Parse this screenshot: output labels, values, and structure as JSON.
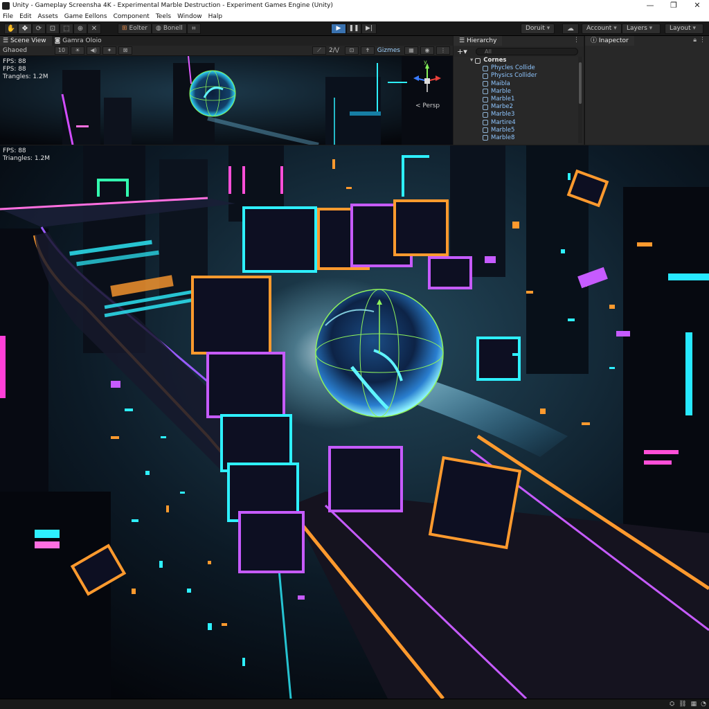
{
  "window": {
    "title": "Unity - Gameplay Screensha 4K - Experimental Marble Destruction - Experiment Games Engine (Unity)",
    "min_icon": "minimize-icon",
    "max_icon": "maximize-icon",
    "close_icon": "close-icon"
  },
  "menu": [
    "File",
    "Edit",
    "Assets",
    "Game Eellons",
    "Component",
    "Teels",
    "Window",
    "Halp"
  ],
  "toolbar": {
    "tools": [
      "hand-tool-icon",
      "move-tool-icon",
      "rotate-tool-icon",
      "scale-tool-icon",
      "rect-tool-icon",
      "transform-tool-icon",
      "custom-tool-icon"
    ],
    "pivot_label": "Eolter",
    "global_label": "Bonell",
    "collab_label": "Doruit",
    "account_label": "Account",
    "layers_label": "Layers",
    "layout_label": "Layout"
  },
  "scene": {
    "tabs": [
      "Scene View",
      "Gamra Oloio"
    ],
    "shading": "Ghaoed",
    "mode_2d": "2/\\/",
    "gizmos_label": "Gizmes",
    "persp_label": "< Persp",
    "axis_y": "y",
    "stats": [
      "FPS: 88",
      "FPS: 88",
      "Trangles: 1.2M"
    ]
  },
  "game": {
    "stats": [
      "FPS: 88",
      "Triangles: 1.2M"
    ]
  },
  "hierarchy": {
    "tab": "Hierarchy",
    "search_placeholder": "All",
    "root": "Cornes",
    "items": [
      "Phycles Collide",
      "Physics Collider",
      "Maibla",
      "Marble",
      "Marble1",
      "Marbe2",
      "Marble3",
      "Martire4",
      "Marble5",
      "Marble8"
    ]
  },
  "inspector": {
    "tab": "Inapector"
  },
  "colors": {
    "accent_blue": "#3a72b0",
    "neon_cyan": "#27e8ff",
    "neon_orange": "#ff9a2e",
    "neon_purple": "#c65bff",
    "neon_magenta": "#ff3fd8"
  }
}
